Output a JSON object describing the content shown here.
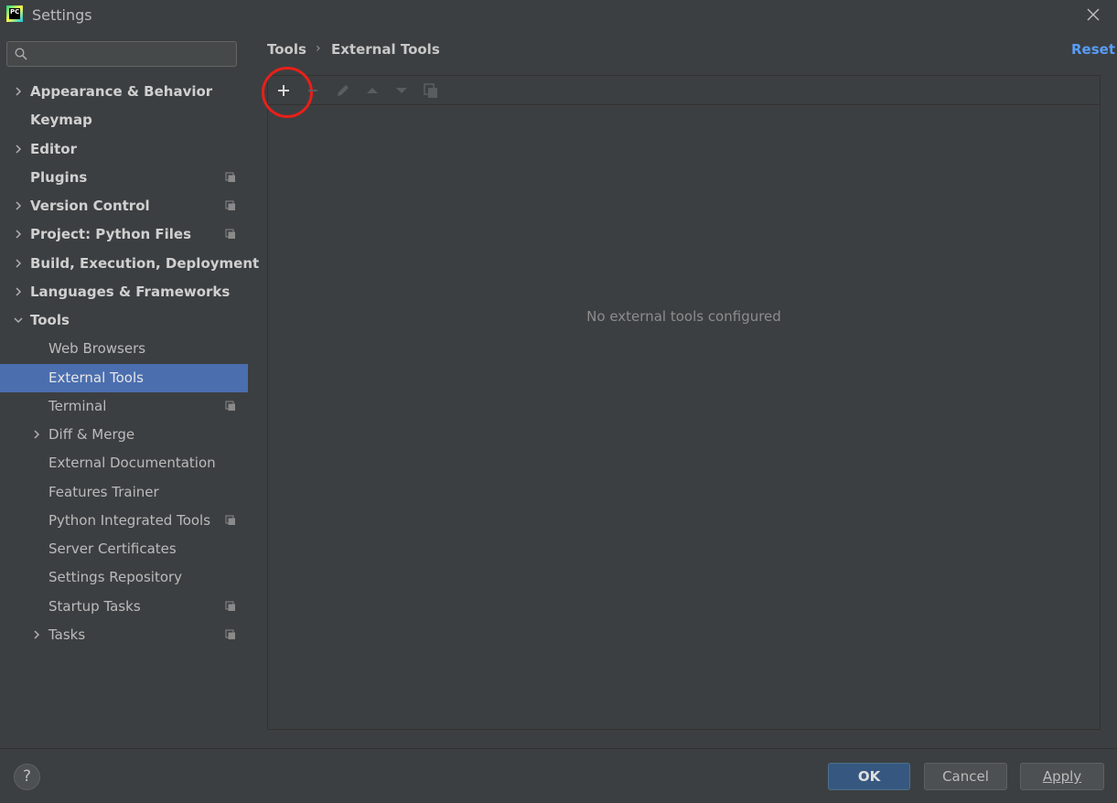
{
  "window": {
    "title": "Settings",
    "logo_text": "PC",
    "accent": "#4b6eaf"
  },
  "search": {
    "placeholder": "",
    "value": ""
  },
  "sidebar": {
    "items": [
      {
        "label": "Appearance & Behavior",
        "level": 0,
        "expandable": true,
        "expanded": false,
        "bold": true,
        "project_icon": false
      },
      {
        "label": "Keymap",
        "level": 0,
        "expandable": false,
        "bold": true,
        "project_icon": false
      },
      {
        "label": "Editor",
        "level": 0,
        "expandable": true,
        "expanded": false,
        "bold": true,
        "project_icon": false
      },
      {
        "label": "Plugins",
        "level": 0,
        "expandable": false,
        "bold": true,
        "project_icon": true
      },
      {
        "label": "Version Control",
        "level": 0,
        "expandable": true,
        "expanded": false,
        "bold": true,
        "project_icon": true
      },
      {
        "label": "Project: Python Files",
        "level": 0,
        "expandable": true,
        "expanded": false,
        "bold": true,
        "project_icon": true
      },
      {
        "label": "Build, Execution, Deployment",
        "level": 0,
        "expandable": true,
        "expanded": false,
        "bold": true,
        "project_icon": false
      },
      {
        "label": "Languages & Frameworks",
        "level": 0,
        "expandable": true,
        "expanded": false,
        "bold": true,
        "project_icon": false
      },
      {
        "label": "Tools",
        "level": 0,
        "expandable": true,
        "expanded": true,
        "bold": true,
        "project_icon": false
      },
      {
        "label": "Web Browsers",
        "level": 1,
        "expandable": false,
        "project_icon": false
      },
      {
        "label": "External Tools",
        "level": 1,
        "expandable": false,
        "project_icon": false,
        "selected": true
      },
      {
        "label": "Terminal",
        "level": 1,
        "expandable": false,
        "project_icon": true
      },
      {
        "label": "Diff & Merge",
        "level": 1,
        "expandable": true,
        "expanded": false,
        "project_icon": false
      },
      {
        "label": "External Documentation",
        "level": 1,
        "expandable": false,
        "project_icon": false
      },
      {
        "label": "Features Trainer",
        "level": 1,
        "expandable": false,
        "project_icon": false
      },
      {
        "label": "Python Integrated Tools",
        "level": 1,
        "expandable": false,
        "project_icon": true
      },
      {
        "label": "Server Certificates",
        "level": 1,
        "expandable": false,
        "project_icon": false
      },
      {
        "label": "Settings Repository",
        "level": 1,
        "expandable": false,
        "project_icon": false
      },
      {
        "label": "Startup Tasks",
        "level": 1,
        "expandable": false,
        "project_icon": true
      },
      {
        "label": "Tasks",
        "level": 1,
        "expandable": true,
        "expanded": false,
        "project_icon": true
      }
    ]
  },
  "breadcrumb": {
    "parent": "Tools",
    "separator": "›",
    "current": "External Tools"
  },
  "reset_label": "Reset",
  "toolbar": {
    "buttons": [
      "add-icon",
      "remove-icon",
      "edit-icon",
      "move-up-icon",
      "move-down-icon",
      "copy-icon"
    ],
    "highlighted": "add-icon"
  },
  "empty_message": "No external tools configured",
  "footer": {
    "help_label": "?",
    "ok_label": "OK",
    "cancel_label": "Cancel",
    "apply_label": "Apply"
  }
}
